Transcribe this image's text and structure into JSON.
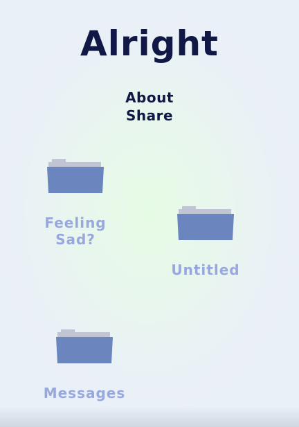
{
  "app": {
    "title": "Alright"
  },
  "menu": {
    "items": [
      {
        "label": "About"
      },
      {
        "label": "Share"
      }
    ]
  },
  "folders": [
    {
      "label": "Feeling Sad?",
      "icon": "folder-icon"
    },
    {
      "label": "Untitled",
      "icon": "folder-icon"
    },
    {
      "label": "Messages",
      "icon": "folder-icon"
    }
  ],
  "colors": {
    "title": "#121846",
    "folder_body": "#6b86bf",
    "folder_tab": "#c1c4d2",
    "folder_label": "#98a8dc"
  }
}
